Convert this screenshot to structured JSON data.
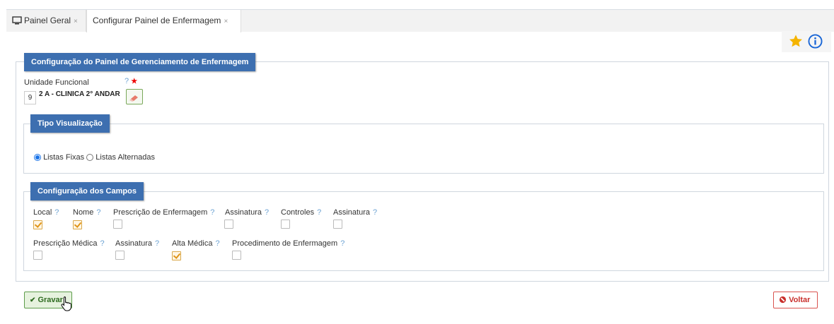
{
  "tabs": [
    {
      "label": "Painel Geral",
      "close": "×"
    },
    {
      "label": "Configurar Painel de Enfermagem",
      "close": "×"
    }
  ],
  "toolbar": {
    "favorite_icon": "star-icon",
    "info_icon": "info-icon"
  },
  "main_panel": {
    "title": "Configuração do Painel de Gerenciamento de Enfermagem",
    "unit": {
      "label": "Unidade Funcional",
      "help": "?",
      "required": "★",
      "code": "9",
      "name": "2 A - CLINICA 2° ANDAR"
    }
  },
  "visualization": {
    "title": "Tipo Visualização",
    "options": [
      {
        "label": "Listas Fixas",
        "selected": true
      },
      {
        "label": "Listas Alternadas",
        "selected": false
      }
    ]
  },
  "fields": {
    "title": "Configuração dos Campos",
    "row1": [
      {
        "label": "Local",
        "checked": true
      },
      {
        "label": "Nome",
        "checked": true
      },
      {
        "label": "Prescrição de Enfermagem",
        "checked": false
      },
      {
        "label": "Assinatura",
        "checked": false
      },
      {
        "label": "Controles",
        "checked": false
      },
      {
        "label": "Assinatura",
        "checked": false
      }
    ],
    "row2": [
      {
        "label": "Prescrição Médica",
        "checked": false
      },
      {
        "label": "Assinatura",
        "checked": false
      },
      {
        "label": "Alta Médica",
        "checked": true
      },
      {
        "label": "Procedimento de Enfermagem",
        "checked": false
      }
    ],
    "help": "?"
  },
  "actions": {
    "save": "Gravar",
    "back": "Voltar"
  },
  "colors": {
    "legend": "#3d6fb0",
    "checked": "#e0951a",
    "save": "#5d9c4a",
    "back": "#c9302c",
    "star": "#f5b400"
  }
}
